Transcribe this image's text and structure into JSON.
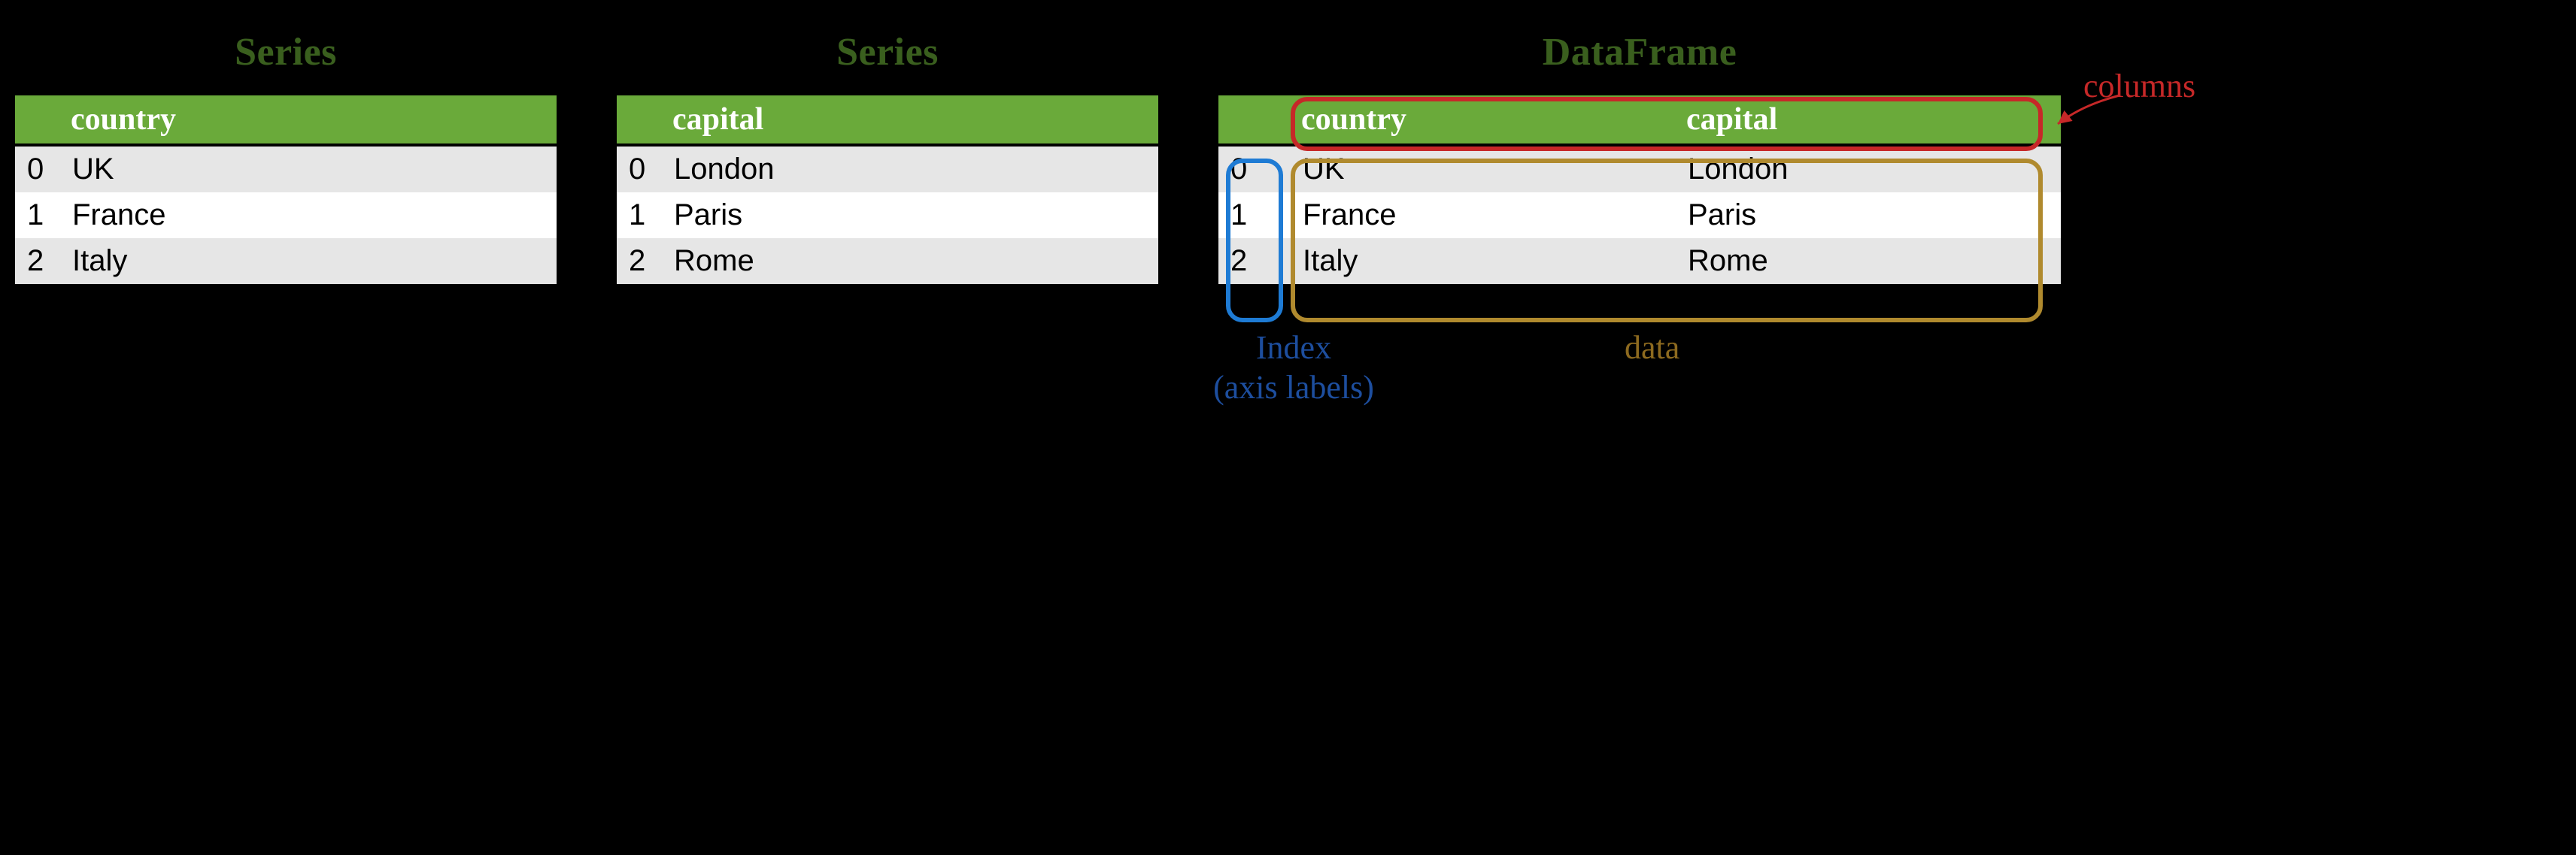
{
  "series1": {
    "title": "Series",
    "column": "country",
    "rows": [
      {
        "idx": "0",
        "val": "UK"
      },
      {
        "idx": "1",
        "val": "France"
      },
      {
        "idx": "2",
        "val": "Italy"
      }
    ]
  },
  "series2": {
    "title": "Series",
    "column": "capital",
    "rows": [
      {
        "idx": "0",
        "val": "London"
      },
      {
        "idx": "1",
        "val": "Paris"
      },
      {
        "idx": "2",
        "val": "Rome"
      }
    ]
  },
  "df": {
    "title": "DataFrame",
    "columns": [
      "country",
      "capital"
    ],
    "rows": [
      {
        "idx": "0",
        "country": "UK",
        "capital": "London"
      },
      {
        "idx": "1",
        "country": "France",
        "capital": "Paris"
      },
      {
        "idx": "2",
        "country": "Italy",
        "capital": "Rome"
      }
    ]
  },
  "annotations": {
    "columns": "columns",
    "index_line1": "Index",
    "index_line2": "(axis labels)",
    "data": "data"
  },
  "colors": {
    "header_bg": "#6aaa3a",
    "title_fg": "#3a5f1e",
    "anno_columns": "#c62828",
    "anno_index_border": "#1e7bd4",
    "anno_index_text": "#1d4e9e",
    "anno_data_border": "#b08a2e",
    "anno_data_text": "#8d6a1f"
  }
}
